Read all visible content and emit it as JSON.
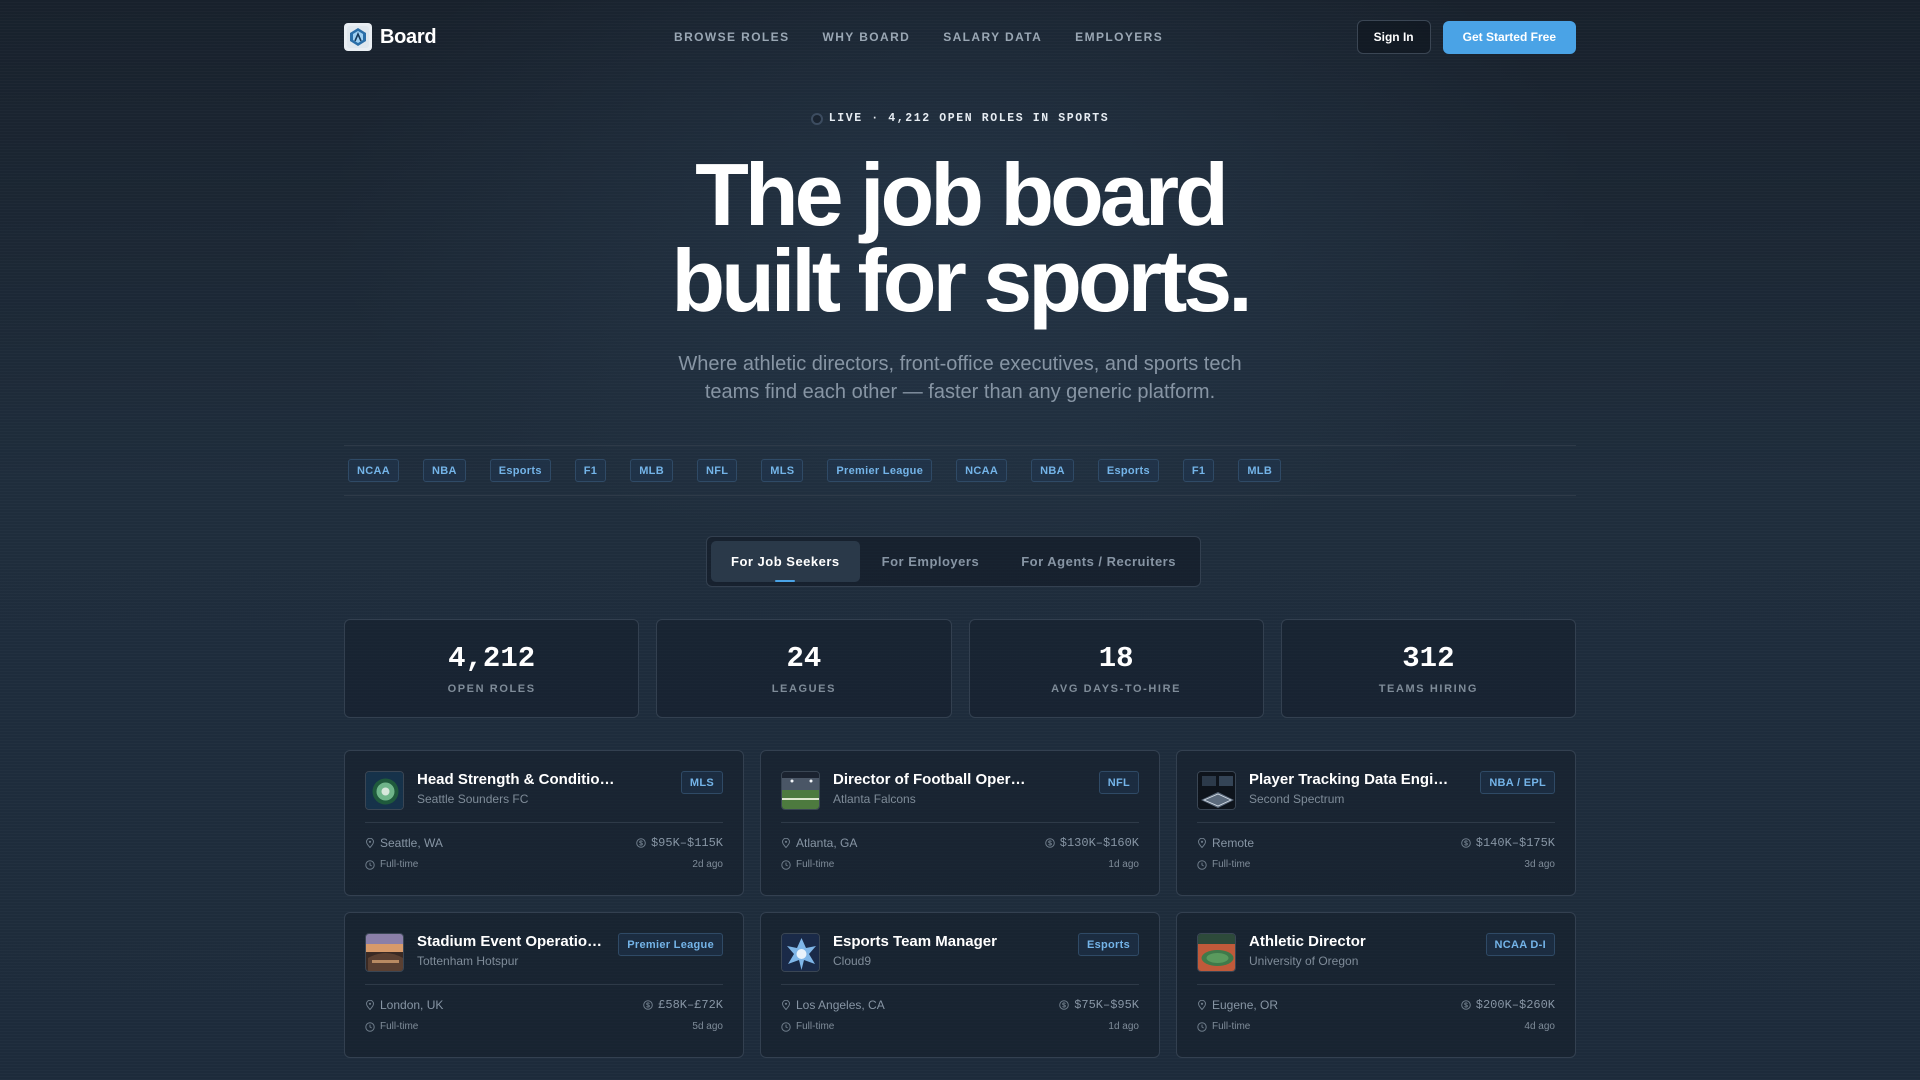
{
  "brand": {
    "name": "Board"
  },
  "nav": {
    "links": [
      "BROWSE ROLES",
      "WHY BOARD",
      "SALARY DATA",
      "EMPLOYERS"
    ],
    "sign_in": "Sign In",
    "get_started": "Get Started Free"
  },
  "hero": {
    "live_label": "LIVE · 4,212 OPEN ROLES IN SPORTS",
    "title_line1": "The job board",
    "title_line2": "built for sports.",
    "subtitle": "Where athletic directors, front-office executives, and sports tech teams find each other — faster than any generic platform."
  },
  "leagues": [
    "NCAA",
    "NBA",
    "Esports",
    "F1",
    "MLB",
    "NFL",
    "MLS",
    "Premier League",
    "NCAA",
    "NBA",
    "Esports",
    "F1",
    "MLB"
  ],
  "tabs": [
    "For Job Seekers",
    "For Employers",
    "For Agents / Recruiters"
  ],
  "stats": [
    {
      "value": "4,212",
      "label": "OPEN ROLES"
    },
    {
      "value": "24",
      "label": "LEAGUES"
    },
    {
      "value": "18",
      "label": "AVG DAYS-TO-HIRE"
    },
    {
      "value": "312",
      "label": "TEAMS HIRING"
    }
  ],
  "jobs": [
    {
      "title": "Head Strength & Conditioning Coach",
      "company": "Seattle Sounders FC",
      "tag": "MLS",
      "location": "Seattle, WA",
      "salary": "$95K–$115K",
      "type": "Full-time",
      "posted": "2d ago"
    },
    {
      "title": "Director of Football Operations",
      "company": "Atlanta Falcons",
      "tag": "NFL",
      "location": "Atlanta, GA",
      "salary": "$130K–$160K",
      "type": "Full-time",
      "posted": "1d ago"
    },
    {
      "title": "Player Tracking Data Engineer",
      "company": "Second Spectrum",
      "tag": "NBA / EPL",
      "location": "Remote",
      "salary": "$140K–$175K",
      "type": "Full-time",
      "posted": "3d ago"
    },
    {
      "title": "Stadium Event Operations Manager",
      "company": "Tottenham Hotspur",
      "tag": "Premier League",
      "location": "London, UK",
      "salary": "£58K–£72K",
      "type": "Full-time",
      "posted": "5d ago"
    },
    {
      "title": "Esports Team Manager",
      "company": "Cloud9",
      "tag": "Esports",
      "location": "Los Angeles, CA",
      "salary": "$75K–$95K",
      "type": "Full-time",
      "posted": "1d ago"
    },
    {
      "title": "Athletic Director",
      "company": "University of Oregon",
      "tag": "NCAA D-I",
      "location": "Eugene, OR",
      "salary": "$200K–$260K",
      "type": "Full-time",
      "posted": "4d ago"
    }
  ],
  "icons": {
    "logo": "board-logo-icon",
    "location": "map-pin-icon",
    "salary": "dollar-icon",
    "type": "clock-icon",
    "live": "live-dot-icon"
  },
  "colors": {
    "accent": "#4aa3e6",
    "tag_text": "#74b4e8",
    "background": "#1d2b3b"
  }
}
